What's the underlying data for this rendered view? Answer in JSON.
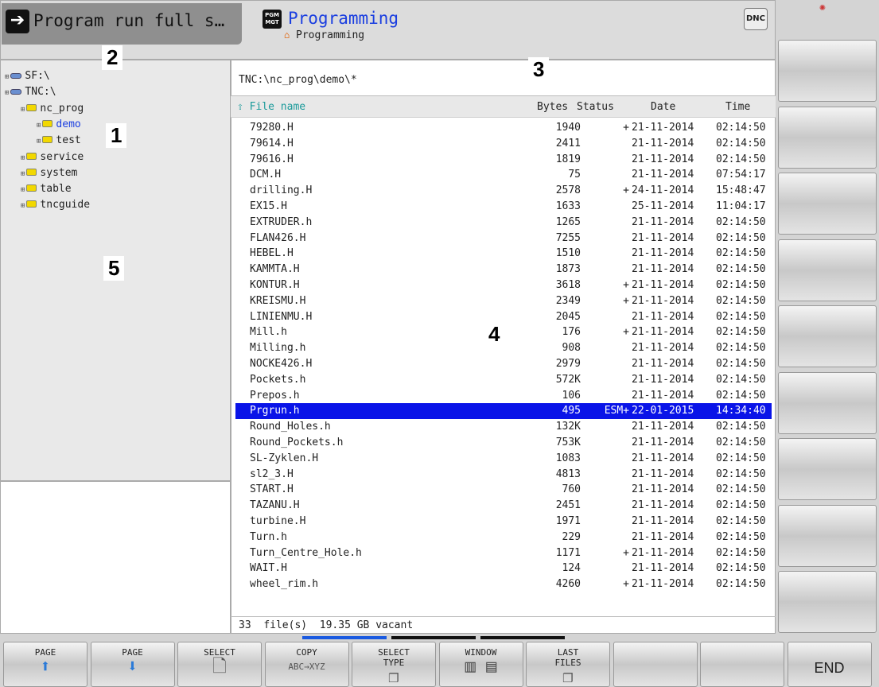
{
  "header": {
    "mode_left": "Program run full s…",
    "mode_icon": "exit-arrow-icon",
    "pgm_badge": "PGM MGT",
    "mode_active": "Programming",
    "breadcrumb": "Programming",
    "dnc": "DNC"
  },
  "tree": [
    {
      "label": "SF:\\",
      "type": "drive",
      "level": 0
    },
    {
      "label": "TNC:\\",
      "type": "drive",
      "level": 0
    },
    {
      "label": "nc_prog",
      "type": "folder",
      "level": 1
    },
    {
      "label": "demo",
      "type": "folder",
      "level": 2,
      "active": true
    },
    {
      "label": "test",
      "type": "folder",
      "level": 2
    },
    {
      "label": "service",
      "type": "folder",
      "level": 1
    },
    {
      "label": "system",
      "type": "folder",
      "level": 1
    },
    {
      "label": "table",
      "type": "folder",
      "level": 1
    },
    {
      "label": "tncguide",
      "type": "folder",
      "level": 1
    }
  ],
  "path": "TNC:\\nc_prog\\demo\\*",
  "columns": {
    "name": "File name",
    "bytes": "Bytes",
    "status": "Status",
    "date": "Date",
    "time": "Time"
  },
  "files": [
    [
      "79280.H",
      "1940",
      "+",
      "21-11-2014",
      "02:14:50"
    ],
    [
      "79614.H",
      "2411",
      "",
      "21-11-2014",
      "02:14:50"
    ],
    [
      "79616.H",
      "1819",
      "",
      "21-11-2014",
      "02:14:50"
    ],
    [
      "DCM.H",
      "75",
      "",
      "21-11-2014",
      "07:54:17"
    ],
    [
      "drilling.H",
      "2578",
      "+",
      "24-11-2014",
      "15:48:47"
    ],
    [
      "EX15.H",
      "1633",
      "",
      "25-11-2014",
      "11:04:17"
    ],
    [
      "EXTRUDER.h",
      "1265",
      "",
      "21-11-2014",
      "02:14:50"
    ],
    [
      "FLAN426.H",
      "7255",
      "",
      "21-11-2014",
      "02:14:50"
    ],
    [
      "HEBEL.H",
      "1510",
      "",
      "21-11-2014",
      "02:14:50"
    ],
    [
      "KAMMTA.H",
      "1873",
      "",
      "21-11-2014",
      "02:14:50"
    ],
    [
      "KONTUR.H",
      "3618",
      "+",
      "21-11-2014",
      "02:14:50"
    ],
    [
      "KREISMU.H",
      "2349",
      "+",
      "21-11-2014",
      "02:14:50"
    ],
    [
      "LINIENMU.H",
      "2045",
      "",
      "21-11-2014",
      "02:14:50"
    ],
    [
      "Mill.h",
      "176",
      "+",
      "21-11-2014",
      "02:14:50"
    ],
    [
      "Milling.h",
      "908",
      "",
      "21-11-2014",
      "02:14:50"
    ],
    [
      "NOCKE426.H",
      "2979",
      "",
      "21-11-2014",
      "02:14:50"
    ],
    [
      "Pockets.h",
      "572K",
      "",
      "21-11-2014",
      "02:14:50"
    ],
    [
      "Prepos.h",
      "106",
      "",
      "21-11-2014",
      "02:14:50"
    ],
    [
      "Prgrun.h",
      "495",
      "ESM+",
      "22-01-2015",
      "14:34:40"
    ],
    [
      "Round_Holes.h",
      "132K",
      "",
      "21-11-2014",
      "02:14:50"
    ],
    [
      "Round_Pockets.h",
      "753K",
      "",
      "21-11-2014",
      "02:14:50"
    ],
    [
      "SL-Zyklen.H",
      "1083",
      "",
      "21-11-2014",
      "02:14:50"
    ],
    [
      "sl2_3.H",
      "4813",
      "",
      "21-11-2014",
      "02:14:50"
    ],
    [
      "START.H",
      "760",
      "",
      "21-11-2014",
      "02:14:50"
    ],
    [
      "TAZANU.H",
      "2451",
      "",
      "21-11-2014",
      "02:14:50"
    ],
    [
      "turbine.H",
      "1971",
      "",
      "21-11-2014",
      "02:14:50"
    ],
    [
      "Turn.h",
      "229",
      "",
      "21-11-2014",
      "02:14:50"
    ],
    [
      "Turn_Centre_Hole.h",
      "1171",
      "+",
      "21-11-2014",
      "02:14:50"
    ],
    [
      "WAIT.H",
      "124",
      "",
      "21-11-2014",
      "02:14:50"
    ],
    [
      "wheel_rim.h",
      "4260",
      "+",
      "21-11-2014",
      "02:14:50"
    ]
  ],
  "selected_file": "Prgrun.h",
  "status": {
    "count": "33",
    "files_label": "file(s)",
    "vacant": "19.35 GB vacant"
  },
  "softkeys": [
    {
      "label": "PAGE",
      "icon": "arrow-up-icon",
      "glyph": "⬆"
    },
    {
      "label": "PAGE",
      "icon": "arrow-down-icon",
      "glyph": "⬇"
    },
    {
      "label": "SELECT",
      "icon": "select-file-icon",
      "glyph": "🗋"
    },
    {
      "label": "COPY",
      "icon": "copy-abc-xyz-icon",
      "glyph": "ABC→XYZ"
    },
    {
      "label": "SELECT",
      "icon": "select-type-icon",
      "glyph": "❐",
      "sub": "TYPE"
    },
    {
      "label": "WINDOW",
      "icon": "window-layout-icon",
      "glyph": "▥ ▤"
    },
    {
      "label": "LAST",
      "icon": "last-files-icon",
      "glyph": "❐",
      "sub": "FILES"
    },
    {
      "label": "",
      "icon": "",
      "glyph": ""
    },
    {
      "label": "",
      "icon": "",
      "glyph": ""
    },
    {
      "label": "END",
      "icon": "",
      "glyph": ""
    }
  ],
  "callouts": [
    "1",
    "2",
    "3",
    "4",
    "5"
  ],
  "colors": {
    "selection": "#0a14e8",
    "active_mode": "#1a3ee0",
    "column_header": "#1a9a9a",
    "folder": "#f2d800"
  }
}
